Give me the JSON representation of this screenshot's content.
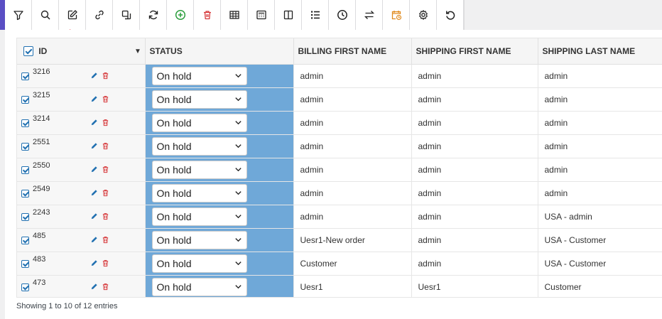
{
  "toolbar": {
    "buttons": [
      {
        "name": "filter-icon"
      },
      {
        "name": "search-icon"
      },
      {
        "name": "edit-icon"
      },
      {
        "name": "link-icon"
      },
      {
        "name": "duplicate-icon"
      },
      {
        "name": "refresh-icon"
      },
      {
        "name": "add-icon"
      },
      {
        "name": "trash-icon"
      },
      {
        "name": "table-icon"
      },
      {
        "name": "calculator-icon"
      },
      {
        "name": "columns-icon"
      },
      {
        "name": "list-icon"
      },
      {
        "name": "clock-icon"
      },
      {
        "name": "swap-icon"
      },
      {
        "name": "calendar-clock-icon"
      },
      {
        "name": "gear-icon"
      },
      {
        "name": "undo-icon"
      }
    ],
    "colors": {
      "add": "#2a9d3c",
      "trash": "#d63638",
      "calendar": "#e08a1e"
    }
  },
  "table": {
    "headers": {
      "id": "ID",
      "status": "STATUS",
      "billing_first_name": "BILLING FIRST NAME",
      "shipping_first_name": "SHIPPING FIRST NAME",
      "shipping_last_name": "SHIPPING LAST NAME"
    },
    "rows": [
      {
        "id": "3216",
        "status": "On hold",
        "billing_first_name": "admin",
        "shipping_first_name": "admin",
        "shipping_last_name": "admin"
      },
      {
        "id": "3215",
        "status": "On hold",
        "billing_first_name": "admin",
        "shipping_first_name": "admin",
        "shipping_last_name": "admin"
      },
      {
        "id": "3214",
        "status": "On hold",
        "billing_first_name": "admin",
        "shipping_first_name": "admin",
        "shipping_last_name": "admin"
      },
      {
        "id": "2551",
        "status": "On hold",
        "billing_first_name": "admin",
        "shipping_first_name": "admin",
        "shipping_last_name": "admin"
      },
      {
        "id": "2550",
        "status": "On hold",
        "billing_first_name": "admin",
        "shipping_first_name": "admin",
        "shipping_last_name": "admin"
      },
      {
        "id": "2549",
        "status": "On hold",
        "billing_first_name": "admin",
        "shipping_first_name": "admin",
        "shipping_last_name": "admin"
      },
      {
        "id": "2243",
        "status": "On hold",
        "billing_first_name": "admin",
        "shipping_first_name": "admin",
        "shipping_last_name": "USA - admin"
      },
      {
        "id": "485",
        "status": "On hold",
        "billing_first_name": "Uesr1-New order",
        "shipping_first_name": "admin",
        "shipping_last_name": "USA - Customer"
      },
      {
        "id": "483",
        "status": "On hold",
        "billing_first_name": "Customer",
        "shipping_first_name": "admin",
        "shipping_last_name": "USA - Customer"
      },
      {
        "id": "473",
        "status": "On hold",
        "billing_first_name": "Uesr1",
        "shipping_first_name": "Uesr1",
        "shipping_last_name": "Customer"
      }
    ]
  },
  "footer": {
    "entries_text": "Showing 1 to 10 of 12 entries"
  },
  "colors": {
    "status_column_bg": "#6fa8d8",
    "checkbox": "#2271b1",
    "edit_icon": "#2271b1",
    "delete_icon": "#d63638",
    "annotation_arrow": "#e0101f"
  }
}
